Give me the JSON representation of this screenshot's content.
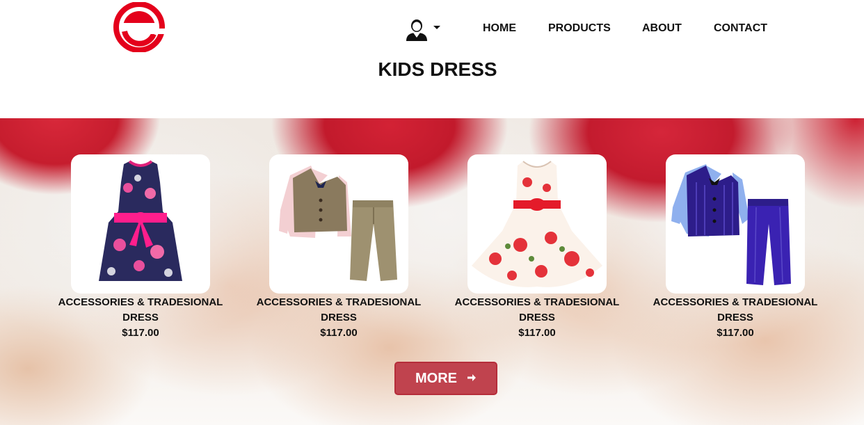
{
  "header": {
    "logo_letter": "e",
    "brand_color": "#e4001b",
    "user_icon": "user-avatar-icon",
    "nav": [
      "HOME",
      "PRODUCTS",
      "ABOUT",
      "CONTACT"
    ]
  },
  "page": {
    "title": "KIDS DRESS"
  },
  "products": [
    {
      "name": "ACCESSORIES & TRADESIONAL DRESS",
      "price": "$117.00",
      "image": "girl-floral-navy-dress-image"
    },
    {
      "name": "ACCESSORIES & TRADESIONAL DRESS",
      "price": "$117.00",
      "image": "boy-vest-suit-image"
    },
    {
      "name": "ACCESSORIES & TRADESIONAL DRESS",
      "price": "$117.00",
      "image": "girl-white-rose-dress-image"
    },
    {
      "name": "ACCESSORIES & TRADESIONAL DRESS",
      "price": "$117.00",
      "image": "boy-purple-suit-image"
    }
  ],
  "more_button": {
    "label": "MORE",
    "icon": "arrow-right-icon",
    "color": "#c0434e"
  }
}
